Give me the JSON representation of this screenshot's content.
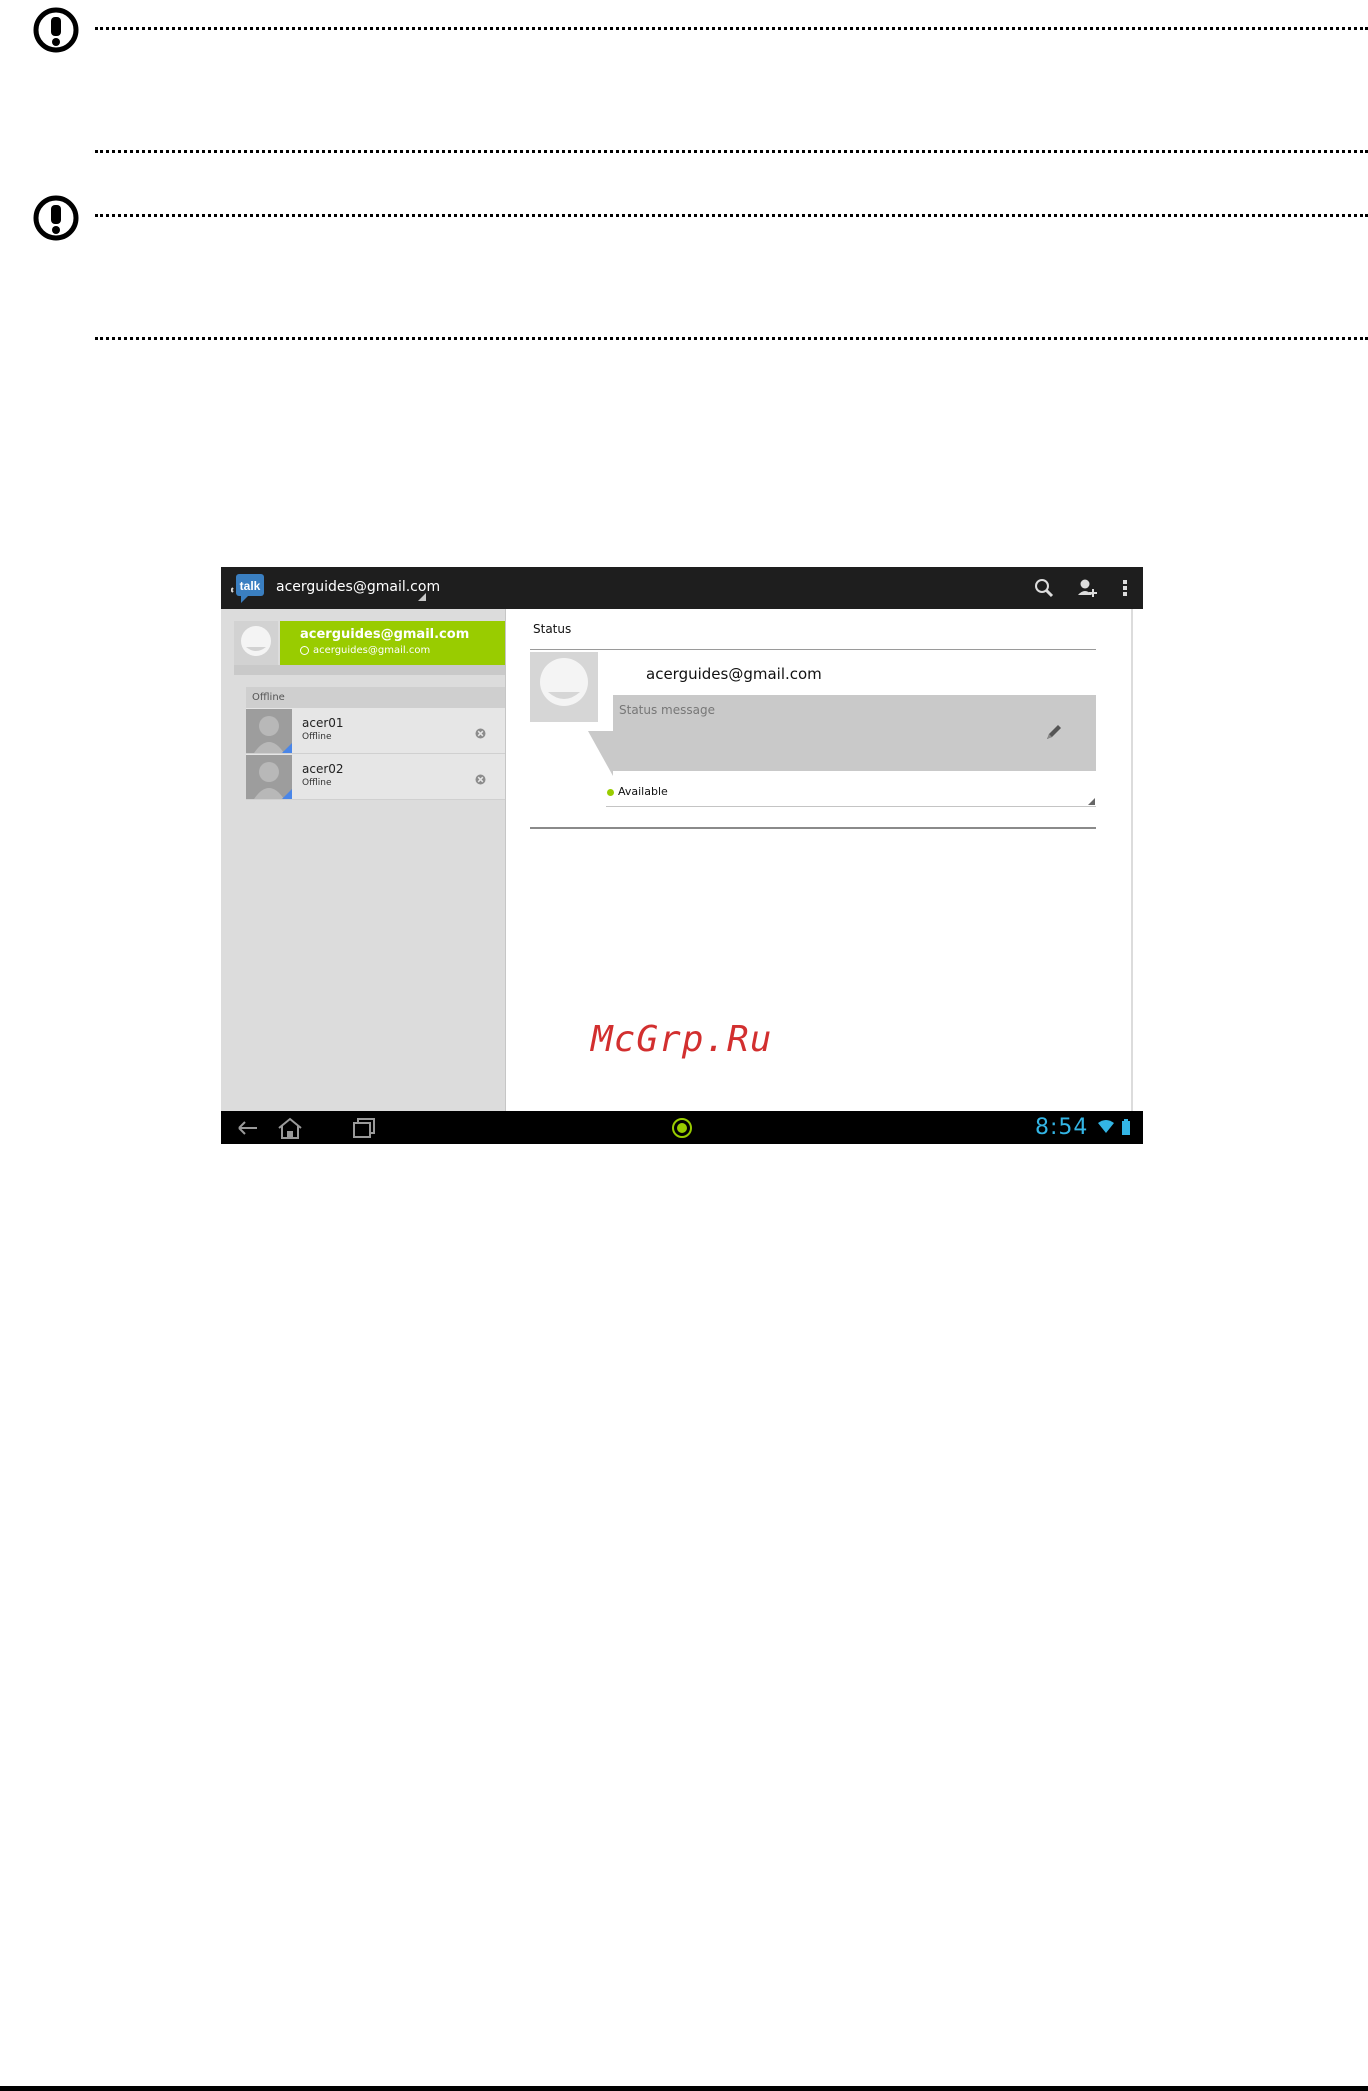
{
  "app": {
    "logo_text": "talk",
    "account_title": "acerguides@gmail.com"
  },
  "sidebar": {
    "me": {
      "name": "acerguides@gmail.com",
      "sub": "acerguides@gmail.com"
    },
    "group_header": "Offline",
    "contacts": [
      {
        "name": "acer01",
        "status": "Offline"
      },
      {
        "name": "acer02",
        "status": "Offline"
      }
    ]
  },
  "detail": {
    "section_label": "Status",
    "email": "acerguides@gmail.com",
    "status_placeholder": "Status message",
    "availability": "Available"
  },
  "watermark": "McGrp.Ru",
  "system": {
    "clock": "8:54"
  },
  "colors": {
    "accent_green": "#99cc00",
    "holo_blue": "#33b5e5",
    "watermark_red": "#d22f2f"
  },
  "icons": [
    "alert-icon",
    "search-icon",
    "add-contact-icon",
    "overflow-menu-icon",
    "pencil-icon",
    "remove-icon",
    "back-icon",
    "home-icon",
    "recent-apps-icon",
    "talk-center-icon",
    "wifi-icon",
    "battery-icon"
  ]
}
